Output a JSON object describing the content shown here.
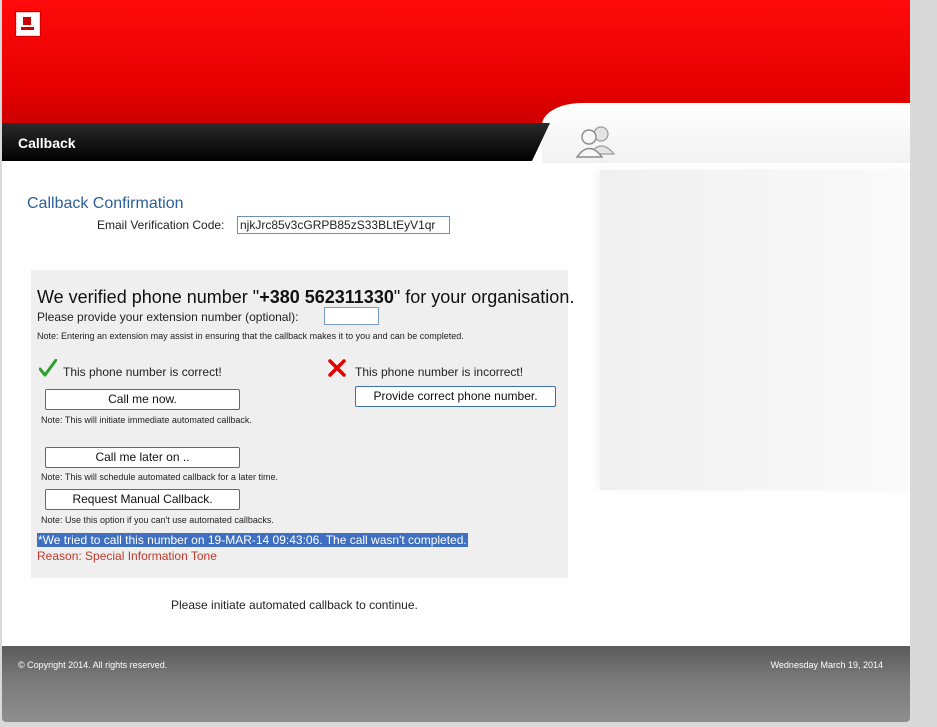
{
  "header": {
    "title": "Callback"
  },
  "confirmation": {
    "title": "Callback Confirmation",
    "code_label": "Email Verification Code:",
    "code_value": "njkJrc85v3cGRPB85zS33BLtEyV1qr"
  },
  "verify": {
    "prefix": "We verified phone number \"",
    "number": "+380 562311330",
    "suffix": "\" for your organisation.",
    "extension_label": "Please provide your extension number (optional):",
    "extension_value": "",
    "extension_note": "Note: Entering an extension may assist in ensuring that the callback makes it to you and can be completed."
  },
  "correct": {
    "label": "This phone number is correct!",
    "call_now_button": "Call me now.",
    "call_now_note": "Note: This will initiate immediate automated callback.",
    "call_later_button": "Call me later on ..",
    "call_later_note": "Note: This will schedule automated callback for a later time.",
    "manual_button": "Request Manual Callback.",
    "manual_note": "Note: Use this option if you can't use automated callbacks."
  },
  "incorrect": {
    "label": "This phone number is incorrect!",
    "provide_button": "Provide correct phone number."
  },
  "attempt": {
    "message": "*We tried to call this number on 19-MAR-14 09:43:06. The call wasn't completed.",
    "reason": "Reason: Special Information Tone"
  },
  "continue_text": "Please initiate automated callback to continue.",
  "footer": {
    "copyright": "© Copyright 2014. All rights reserved.",
    "date": "Wednesday March 19, 2014"
  },
  "colors": {
    "header_red": "#e60000",
    "link_blue": "#2b5f96",
    "highlight_blue": "#3e6fc1",
    "reason_red": "#c0392b",
    "check_green": "#2e9e2e",
    "cross_red": "#e00000"
  },
  "icons": [
    "app-logo-icon",
    "users-icon",
    "checkmark-icon",
    "cross-icon"
  ]
}
